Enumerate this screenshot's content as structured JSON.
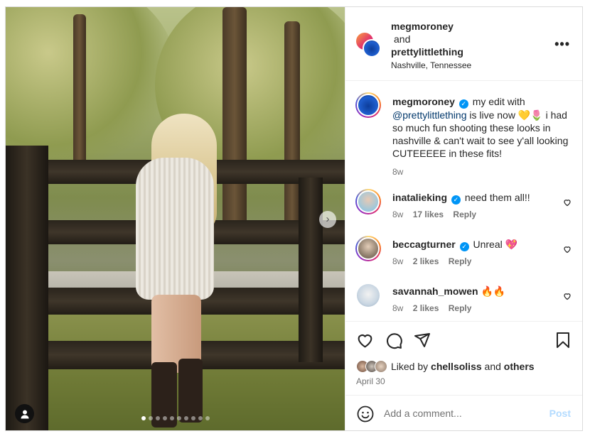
{
  "post": {
    "author": "megmoroney",
    "and_label": "and",
    "collaborator": "prettylittlething",
    "location": "Nashville, Tennessee",
    "more_icon": "more-horizontal-icon"
  },
  "caption": {
    "username": "megmoroney",
    "text_part1": "my edit with",
    "mention": "@prettylittlething",
    "text_part2": "is live now 💛🌷 i had so much fun shooting these looks in nashville & can't wait to see y'all looking CUTEEEEE in these fits!",
    "time": "8w"
  },
  "comments": [
    {
      "username": "inatalieking",
      "verified": true,
      "text": "need them all!!",
      "time": "8w",
      "likes": "17 likes",
      "reply": "Reply"
    },
    {
      "username": "beccagturner",
      "verified": true,
      "text": "Unreal 💖",
      "time": "8w",
      "likes": "2 likes",
      "reply": "Reply"
    },
    {
      "username": "savannah_mowen",
      "verified": false,
      "text": "🔥🔥",
      "time": "8w",
      "likes": "2 likes",
      "reply": "Reply"
    }
  ],
  "likes": {
    "prefix": "Liked by",
    "user": "chellsoliss",
    "and_label": "and",
    "others": "others"
  },
  "date": "April 30",
  "add_comment": {
    "placeholder": "Add a comment...",
    "post_label": "Post"
  },
  "carousel": {
    "slides": 10,
    "active_index": 0
  },
  "colors": {
    "link": "#00376b",
    "verified": "#0095f6",
    "post_disabled": "#b3dbff",
    "muted": "#737373"
  }
}
